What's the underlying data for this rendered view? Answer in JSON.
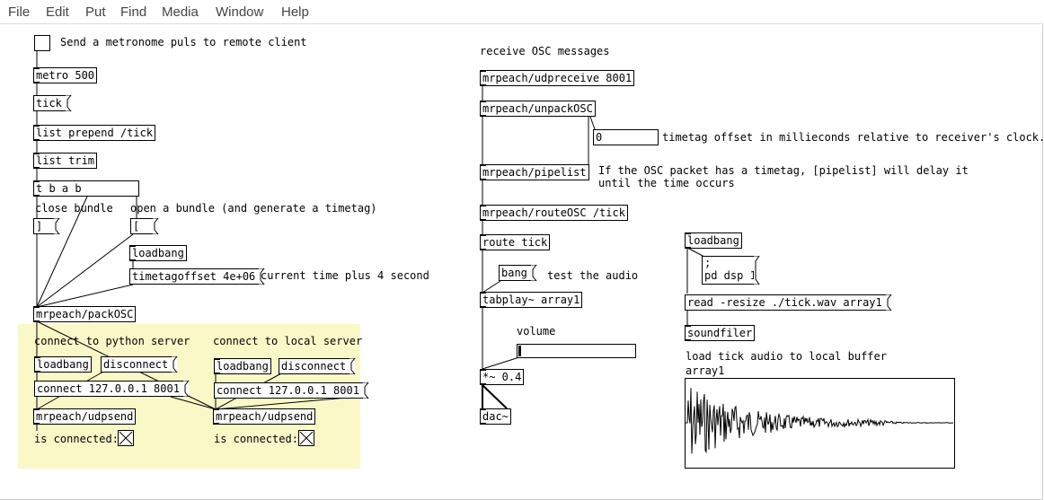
{
  "menu": [
    "File",
    "Edit",
    "Put",
    "Find",
    "Media",
    "Window",
    "Help"
  ],
  "left": {
    "toggle_comment": "Send a metronome puls to remote client",
    "metro": "metro 500",
    "tick_msg": "tick",
    "list_prepend": "list prepend /tick",
    "list_trim": "list trim",
    "tba": "t b a b",
    "close_bundle_comment": "close bundle",
    "open_bundle_comment": "open a bundle (and generate a timetag)",
    "close_msg": "]",
    "open_msg": "[",
    "loadbang": "loadbang",
    "timetagoffset": "timetagoffset 4e+06",
    "current_time_comment": "current time plus 4 second",
    "packosc": "mrpeach/packOSC",
    "python_comment": "connect to python server",
    "local_comment": "connect to local server",
    "loadbang1": "loadbang",
    "disconnect1": "disconnect",
    "connect1": "connect 127.0.0.1 8001",
    "udpsend1": "mrpeach/udpsend",
    "is_connected1": "is connected:",
    "loadbang2": "loadbang",
    "disconnect2": "disconnect",
    "connect2": "connect 127.0.0.1 8001",
    "udpsend2": "mrpeach/udpsend",
    "is_connected2": "is connected:"
  },
  "middle": {
    "receive_comment": "receive OSC messages",
    "udpreceive": "mrpeach/udpreceive 8001",
    "unpackosc": "mrpeach/unpackOSC",
    "numbox_value": "0",
    "timetag_comment": "timetag offset in millieconds relative to receiver's clock.",
    "pipelist": "mrpeach/pipelist",
    "pipelist_comment_1": "If the OSC packet has a timetag, [pipelist] will delay it",
    "pipelist_comment_2": "until the time occurs",
    "routeosc": "mrpeach/routeOSC /tick",
    "route_tick": "route tick",
    "bang_msg": "bang",
    "test_audio_comment": "test the audio",
    "tabplay": "tabplay~ array1",
    "volume_comment": "volume",
    "volume_level": 0.0,
    "mult": "*~ 0.4",
    "dac": "dac~"
  },
  "right": {
    "loadbang": "loadbang",
    "dsp_msg_1": ";",
    "dsp_msg_2": "pd dsp 1",
    "read_msg": "read -resize ./tick.wav array1",
    "soundfiler": "soundfiler",
    "load_comment": "load tick audio to local buffer",
    "array_name": "array1"
  }
}
